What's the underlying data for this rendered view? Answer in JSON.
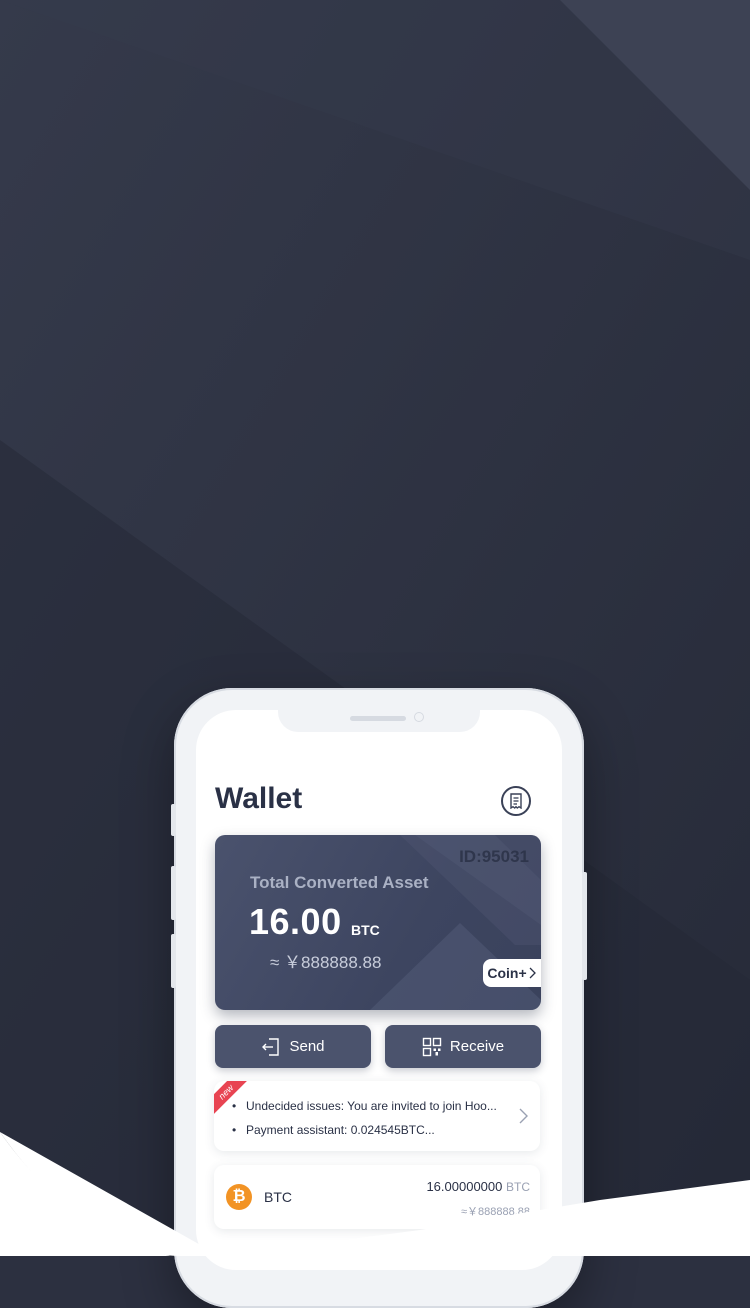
{
  "app": {
    "title": "Wallet",
    "icons": {
      "receipt": "receipt-icon",
      "send": "send-icon",
      "receive": "qr-code-icon",
      "chevron": "chevron-right-icon",
      "coin": "bitcoin-icon"
    }
  },
  "card": {
    "id_text": "ID:95031",
    "label": "Total Converted Asset",
    "amount": "16.00",
    "unit": "BTC",
    "fiat": "≈ ￥888888.88",
    "coin_button": "Coin+",
    "colors": {
      "card": "#434b66",
      "accent": "#ffffff"
    }
  },
  "actions": {
    "send_label": "Send",
    "receive_label": "Receive"
  },
  "notice": {
    "badge": "new",
    "lines": [
      "Undecided issues: You are invited to join Hoo...",
      "Payment assistant:  0.024545BTC..."
    ]
  },
  "assets": [
    {
      "name": "BTC",
      "balance": "16.00000000",
      "unit": "BTC",
      "fiat": "≈￥888888.88"
    }
  ],
  "colors": {
    "background": "#2c3040",
    "badge": "#e84452",
    "btc": "#f29324"
  }
}
